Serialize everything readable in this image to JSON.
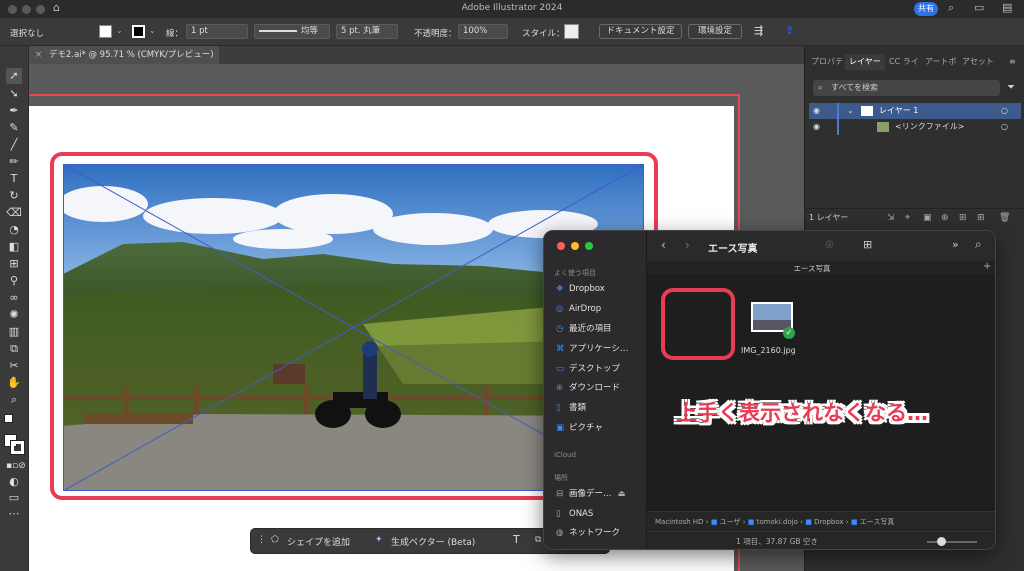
{
  "window": {
    "title": "Adobe Illustrator 2024",
    "share_label": "共有"
  },
  "control_bar": {
    "selection_label": "選択なし",
    "stroke_label": "線：",
    "stroke_weight": "1 pt",
    "stroke_profile": "均等",
    "brush": "5 pt. 丸筆",
    "opacity_label": "不透明度：",
    "opacity_value": "100%",
    "style_label": "スタイル：",
    "doc_setup_button": "ドキュメント設定",
    "prefs_button": "環境設定"
  },
  "document_tab": {
    "label": "デモ2.ai* @ 95.71 % (CMYK/プレビュー)"
  },
  "context_bar": {
    "add_shape": "シェイプを追加",
    "generate_vector": "生成ベクター (Beta)"
  },
  "panel": {
    "tabs": [
      "プロパテ",
      "レイヤー",
      "CC ライ",
      "アートボ",
      "アセット"
    ],
    "active_tab": "レイヤー",
    "search_placeholder": "すべてを検索",
    "layers": [
      {
        "name": "レイヤー 1"
      },
      {
        "name": "<リンクファイル>"
      }
    ],
    "footer_count": "1 レイヤー"
  },
  "finder": {
    "title": "エース写真",
    "subtab": "エース写真",
    "sidebar": {
      "favorites_header": "よく使う項目",
      "favorites": [
        {
          "label": "Dropbox",
          "icon": "dropbox-icon"
        },
        {
          "label": "AirDrop",
          "icon": "airdrop-icon"
        },
        {
          "label": "最近の項目",
          "icon": "clock-icon"
        },
        {
          "label": "アプリケーシ…",
          "icon": "apps-icon"
        },
        {
          "label": "デスクトップ",
          "icon": "desktop-icon"
        },
        {
          "label": "ダウンロード",
          "icon": "download-icon"
        },
        {
          "label": "書類",
          "icon": "document-icon"
        },
        {
          "label": "ピクチャ",
          "icon": "picture-icon"
        }
      ],
      "icloud_header": "iCloud",
      "locations_header": "場所",
      "locations": [
        {
          "label": "画像デー…",
          "icon": "drive-icon"
        },
        {
          "label": "ONAS",
          "icon": "file-icon"
        },
        {
          "label": "ネットワーク",
          "icon": "network-icon"
        }
      ]
    },
    "file": {
      "name": "IMG_2160.jpg"
    },
    "path": [
      "Macintosh HD",
      "ユーザ",
      "tomoki.dojo",
      "Dropbox",
      "エース写真"
    ],
    "status": "1 項目、37.87 GB 空き"
  },
  "annotation": {
    "callout": "上手く表示されなくなる…"
  },
  "colors": {
    "accent_red": "#ea3b55",
    "share_blue": "#2f72e8"
  }
}
